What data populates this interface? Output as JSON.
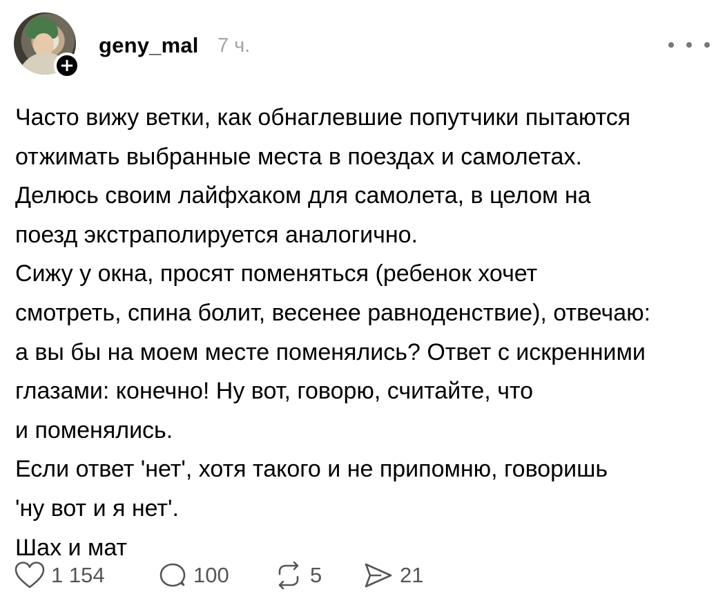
{
  "post": {
    "author": "geny_mal",
    "time": "7 ч.",
    "lines": [
      "Часто вижу ветки, как обнаглевшие попутчики пытаются",
      "отжимать выбранные места в поездах и самолетах.",
      "Делюсь своим лайфхаком для самолета, в целом на",
      "поезд экстраполируется аналогично.",
      "Сижу у окна, просят поменяться (ребенок хочет",
      "смотреть, спина болит, весенее равноденствие), отвечаю:",
      "а вы бы на моем месте поменялись? Ответ с искренними",
      "глазами: конечно! Ну вот, говорю, считайте, что",
      "и поменялись.",
      "Если ответ 'нет', хотя такого и не припомню, говоришь",
      "'ну вот и я нет'.",
      "Шах и мат"
    ]
  },
  "avatar": {
    "icon": "user-avatar",
    "badge_icon": "plus-icon",
    "badge_symbol": "+"
  },
  "actions": {
    "like": {
      "icon": "heart-icon",
      "count": "1 154"
    },
    "reply": {
      "icon": "comment-icon",
      "count": "100"
    },
    "repost": {
      "icon": "repost-icon",
      "count": "5"
    },
    "share": {
      "icon": "send-icon",
      "count": "21"
    }
  },
  "colors": {
    "text": "#000000",
    "muted": "#a3a3a3",
    "icon": "#555555",
    "background": "#ffffff"
  }
}
